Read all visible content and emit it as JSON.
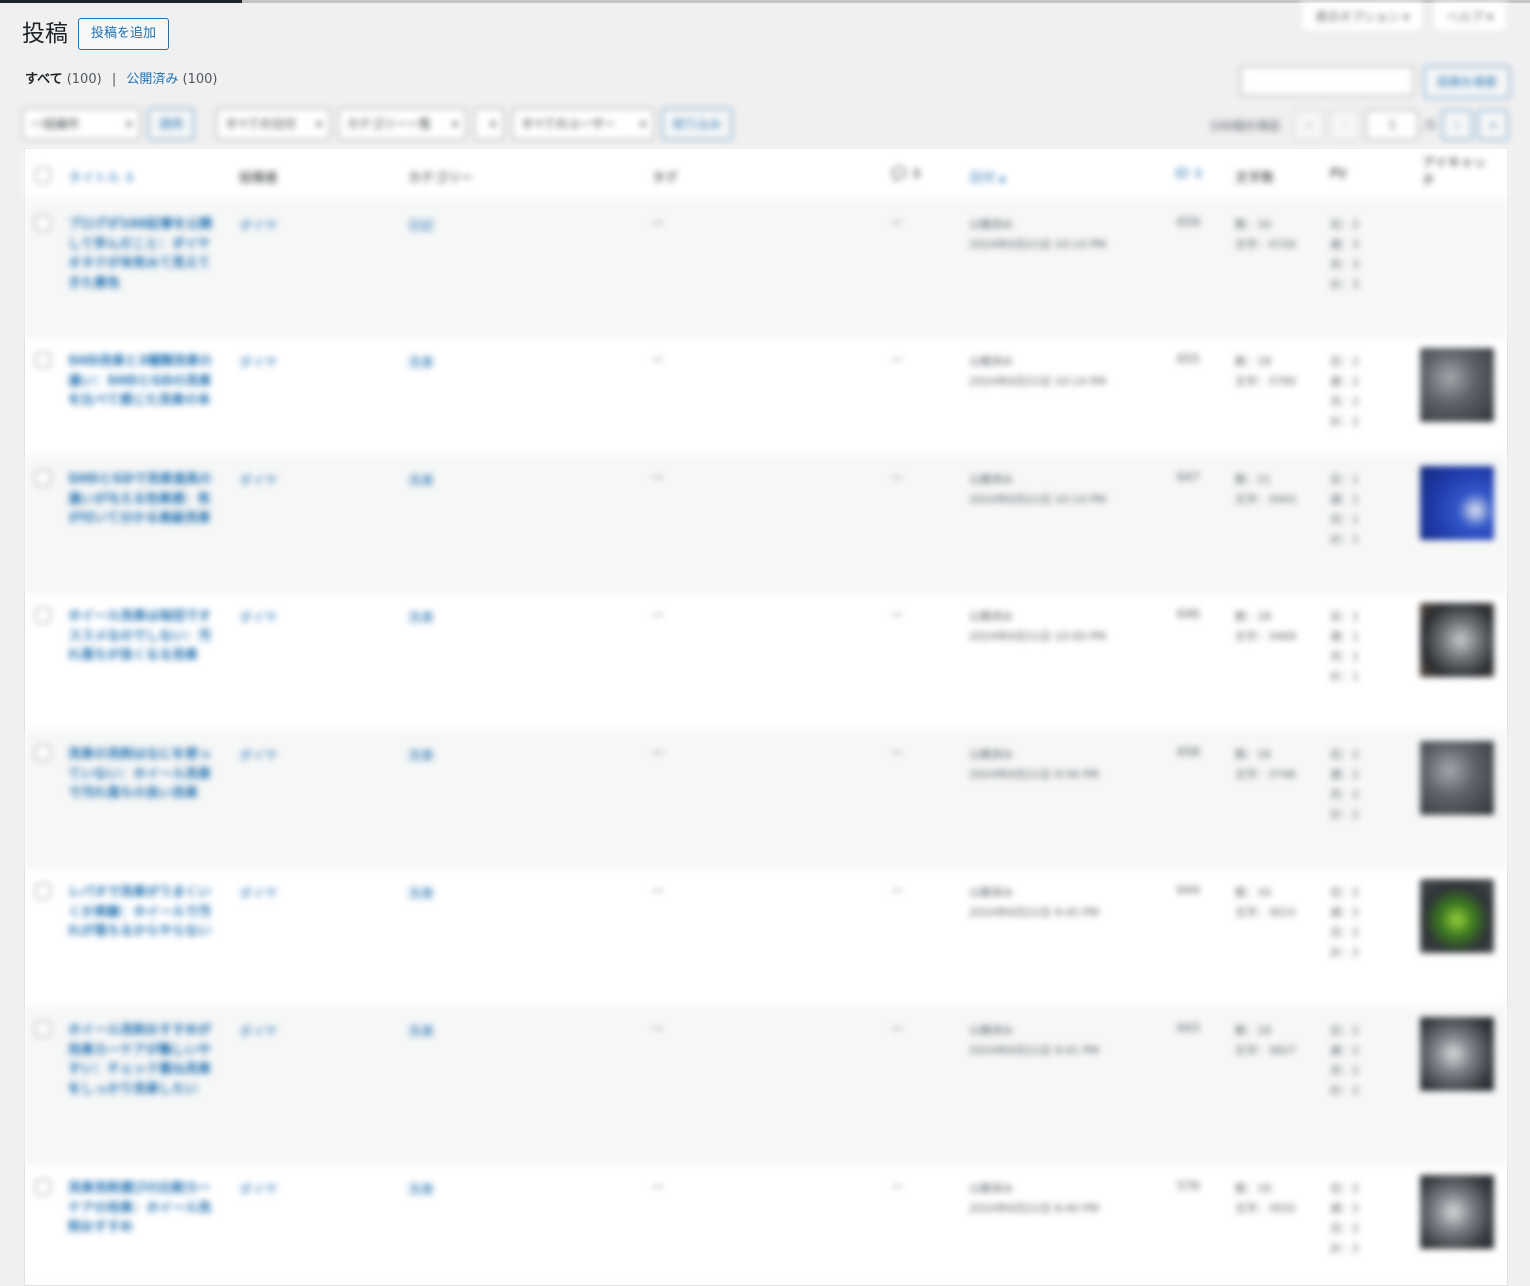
{
  "page": {
    "title": "投稿",
    "add_new": "投稿を追加"
  },
  "screen_meta": {
    "options": "表示オプション ▾",
    "help": "ヘルプ ▾"
  },
  "filters": {
    "all_label": "すべて",
    "all_count": "(100)",
    "published_label": "公開済み",
    "published_count": "(100)"
  },
  "search": {
    "button": "投稿を検索"
  },
  "tablenav": {
    "bulk_action": "一括操作",
    "apply": "適用",
    "dates": "すべての日付",
    "categories": "カテゴリー一覧",
    "format": "",
    "users": "すべてのユーザー",
    "filter": "絞り込み",
    "items": "100個の項目",
    "first": "«",
    "prev": "‹",
    "page": "1",
    "total": "/5",
    "next": "›",
    "last": "»"
  },
  "columns": {
    "title": "タイトル ⇕",
    "author": "投稿者",
    "category": "カテゴリー",
    "tags": "タグ",
    "comments": "💬 ⇕",
    "date": "日付 ▴",
    "id": "ID ⇕",
    "words": "文字数",
    "pv": "PV",
    "thumbnail": "アイキャッチ"
  },
  "rows": [
    {
      "title": "ブログが100記事を公開して学んだこと：ダイヤオタクが本気みて見えてきた景色",
      "author": "ダイヤ",
      "category": "日記",
      "tags": "—",
      "comments": "—",
      "status": "公開済み",
      "date": "2024年6月21日 10:14 PM",
      "id": "659",
      "words1": "数：16",
      "words2": "文字：4726",
      "pv": [
        "日：2",
        "週：3",
        "月：3",
        "計：3"
      ],
      "thumb": ""
    },
    {
      "title": "SHD洗車と3種類洗車の違い：SHDとGDの洗車を比べて感じた洗車の本",
      "author": "ダイヤ",
      "category": "洗車",
      "tags": "—",
      "comments": "—",
      "status": "公開済み",
      "date": "2024年6月21日 10:14 PM",
      "id": "655",
      "words1": "数：18",
      "words2": "文字：3790",
      "pv": [
        "日：2",
        "週：2",
        "月：2",
        "計：2"
      ],
      "thumb": "engine"
    },
    {
      "title": "SHDとGDで洗車道具の違いが与える効果感：気が付いて分かる高級洗車",
      "author": "ダイヤ",
      "category": "洗車",
      "tags": "—",
      "comments": "—",
      "status": "公開済み",
      "date": "2024年6月21日 10:14 PM",
      "id": "647",
      "words1": "数：21",
      "words2": "文字：3443",
      "pv": [
        "日：1",
        "週：1",
        "月：1",
        "計：1"
      ],
      "thumb": "blue"
    },
    {
      "title": "ホイール洗車は毎回でオススメなのでしない：汚れ落ちが良くなる洗車",
      "author": "ダイヤ",
      "category": "洗車",
      "tags": "—",
      "comments": "—",
      "status": "公開済み",
      "date": "2024年6月21日 10:00 PM",
      "id": "646",
      "words1": "数：18",
      "words2": "文字：3469",
      "pv": [
        "日：1",
        "週：1",
        "月：1",
        "計：1"
      ],
      "thumb": "wheel"
    },
    {
      "title": "洗車の洗剤はなにを使っていない：ホイール洗車で汚れ落ちの良い洗車",
      "author": "ダイヤ",
      "category": "洗車",
      "tags": "—",
      "comments": "—",
      "status": "公開済み",
      "date": "2024年6月21日 9:56 PM",
      "id": "658",
      "words1": "数：16",
      "words2": "文字：3746",
      "pv": [
        "日：2",
        "週：2",
        "月：2",
        "計：2"
      ],
      "thumb": "engine"
    },
    {
      "title": "レパタで洗車がうまくいくか実験：ホイールで汚れが落ちるからやらない",
      "author": "ダイヤ",
      "category": "洗車",
      "tags": "—",
      "comments": "—",
      "status": "公開済み",
      "date": "2024年6月21日 9:45 PM",
      "id": "644",
      "words1": "数：16",
      "words2": "文字：3615",
      "pv": [
        "日：2",
        "週：2",
        "月：2",
        "計：2"
      ],
      "thumb": "green"
    },
    {
      "title": "ホイール洗剤おすすめが効果カーケアが難しいやすい：チェック重ね洗車をしっかり洗車したい",
      "author": "ダイヤ",
      "category": "洗車",
      "tags": "—",
      "comments": "—",
      "status": "公開済み",
      "date": "2024年6月21日 9:41 PM",
      "id": "643",
      "words1": "数：18",
      "words2": "文字：3827",
      "pv": [
        "日：2",
        "週：2",
        "月：2",
        "計：2"
      ],
      "thumb": "brake"
    },
    {
      "title": "洗車洗剤選びの比較カーケアの効果：ホイール洗剤おすすめ",
      "author": "ダイヤ",
      "category": "洗車",
      "tags": "—",
      "comments": "—",
      "status": "公開済み",
      "date": "2024年6月21日 8:40 PM",
      "id": "576",
      "words1": "数：18",
      "words2": "文字：3932",
      "pv": [
        "日：2",
        "週：2",
        "月：2",
        "計：2"
      ],
      "thumb": "brake"
    }
  ]
}
